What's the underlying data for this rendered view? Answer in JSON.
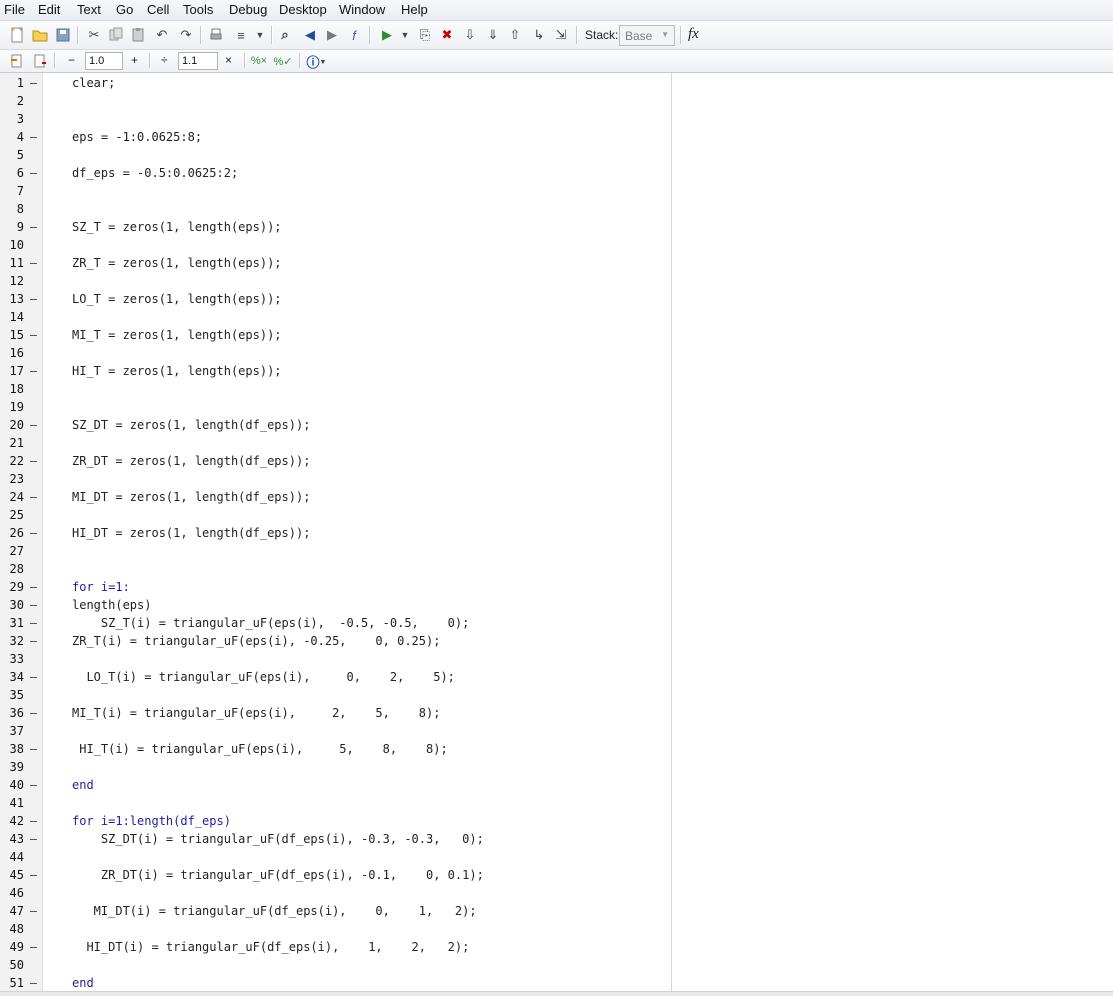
{
  "menu": [
    "File",
    "Edit",
    "Text",
    "Go",
    "Cell",
    "Tools",
    "Debug",
    "Desktop",
    "Window",
    "Help"
  ],
  "toolbar": {
    "stack_label": "Stack:",
    "stack_value": "Base",
    "fx_label": "fx"
  },
  "cellbar": {
    "minus": "−",
    "plus": "+",
    "divide": "÷",
    "times": "×",
    "value1": "1.0",
    "value2": "1.1"
  },
  "editor": {
    "lines": [
      {
        "n": "1",
        "dash": true,
        "text": "clear;"
      },
      {
        "n": "2",
        "dash": false,
        "text": ""
      },
      {
        "n": "3",
        "dash": false,
        "text": ""
      },
      {
        "n": "4",
        "dash": true,
        "text": "eps = -1:0.0625:8;"
      },
      {
        "n": "5",
        "dash": false,
        "text": ""
      },
      {
        "n": "6",
        "dash": true,
        "text": "df_eps = -0.5:0.0625:2;"
      },
      {
        "n": "7",
        "dash": false,
        "text": ""
      },
      {
        "n": "8",
        "dash": false,
        "text": ""
      },
      {
        "n": "9",
        "dash": true,
        "text": "SZ_T = zeros(1, length(eps));"
      },
      {
        "n": "10",
        "dash": false,
        "text": ""
      },
      {
        "n": "11",
        "dash": true,
        "text": "ZR_T = zeros(1, length(eps));"
      },
      {
        "n": "12",
        "dash": false,
        "text": ""
      },
      {
        "n": "13",
        "dash": true,
        "text": "LO_T = zeros(1, length(eps));"
      },
      {
        "n": "14",
        "dash": false,
        "text": ""
      },
      {
        "n": "15",
        "dash": true,
        "text": "MI_T = zeros(1, length(eps));"
      },
      {
        "n": "16",
        "dash": false,
        "text": ""
      },
      {
        "n": "17",
        "dash": true,
        "text": "HI_T = zeros(1, length(eps));"
      },
      {
        "n": "18",
        "dash": false,
        "text": ""
      },
      {
        "n": "19",
        "dash": false,
        "text": ""
      },
      {
        "n": "20",
        "dash": true,
        "text": "SZ_DT = zeros(1, length(df_eps));"
      },
      {
        "n": "21",
        "dash": false,
        "text": ""
      },
      {
        "n": "22",
        "dash": true,
        "text": "ZR_DT = zeros(1, length(df_eps));"
      },
      {
        "n": "23",
        "dash": false,
        "text": ""
      },
      {
        "n": "24",
        "dash": true,
        "text": "MI_DT = zeros(1, length(df_eps));"
      },
      {
        "n": "25",
        "dash": false,
        "text": ""
      },
      {
        "n": "26",
        "dash": true,
        "text": "HI_DT = zeros(1, length(df_eps));"
      },
      {
        "n": "27",
        "dash": false,
        "text": ""
      },
      {
        "n": "28",
        "dash": false,
        "text": ""
      },
      {
        "n": "29",
        "dash": true,
        "text": "for i=1:",
        "kw": true
      },
      {
        "n": "30",
        "dash": true,
        "text": "length(eps)"
      },
      {
        "n": "31",
        "dash": true,
        "text": "    SZ_T(i) = triangular_uF(eps(i),  -0.5, -0.5,    0);"
      },
      {
        "n": "32",
        "dash": true,
        "text": "ZR_T(i) = triangular_uF(eps(i), -0.25,    0, 0.25);"
      },
      {
        "n": "33",
        "dash": false,
        "text": ""
      },
      {
        "n": "34",
        "dash": true,
        "text": "  LO_T(i) = triangular_uF(eps(i),     0,    2,    5);"
      },
      {
        "n": "35",
        "dash": false,
        "text": ""
      },
      {
        "n": "36",
        "dash": true,
        "text": "MI_T(i) = triangular_uF(eps(i),     2,    5,    8);"
      },
      {
        "n": "37",
        "dash": false,
        "text": ""
      },
      {
        "n": "38",
        "dash": true,
        "text": " HI_T(i) = triangular_uF(eps(i),     5,    8,    8);"
      },
      {
        "n": "39",
        "dash": false,
        "text": ""
      },
      {
        "n": "40",
        "dash": true,
        "text": "end",
        "kw": true
      },
      {
        "n": "41",
        "dash": false,
        "text": ""
      },
      {
        "n": "42",
        "dash": true,
        "text": "for i=1:length(df_eps)",
        "kw": true
      },
      {
        "n": "43",
        "dash": true,
        "text": "    SZ_DT(i) = triangular_uF(df_eps(i), -0.3, -0.3,   0);"
      },
      {
        "n": "44",
        "dash": false,
        "text": ""
      },
      {
        "n": "45",
        "dash": true,
        "text": "    ZR_DT(i) = triangular_uF(df_eps(i), -0.1,    0, 0.1);"
      },
      {
        "n": "46",
        "dash": false,
        "text": ""
      },
      {
        "n": "47",
        "dash": true,
        "text": "   MI_DT(i) = triangular_uF(df_eps(i),    0,    1,   2);"
      },
      {
        "n": "48",
        "dash": false,
        "text": ""
      },
      {
        "n": "49",
        "dash": true,
        "text": "  HI_DT(i) = triangular_uF(df_eps(i),    1,    2,   2);"
      },
      {
        "n": "50",
        "dash": false,
        "text": ""
      },
      {
        "n": "51",
        "dash": true,
        "text": "end",
        "kw": true
      }
    ]
  },
  "icons": {
    "new": "new-file-icon",
    "open": "open-folder-icon",
    "save": "save-icon",
    "cut": "cut-icon",
    "copy": "copy-icon",
    "paste": "paste-icon",
    "undo": "undo-icon",
    "redo": "redo-icon",
    "print": "print-icon",
    "publish": "publish-icon",
    "find": "find-icon",
    "back": "back-icon",
    "forward": "forward-icon",
    "function": "function-icon",
    "run": "run-icon",
    "stop": "stop-icon"
  }
}
